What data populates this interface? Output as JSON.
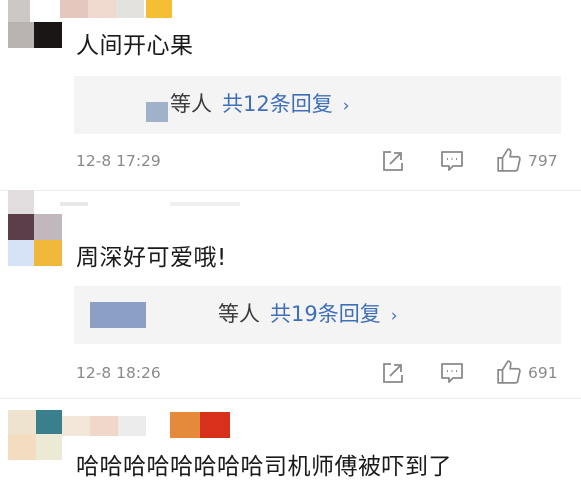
{
  "comments": [
    {
      "text": "人间开心果",
      "reply_by": "等人",
      "reply_count": "共12条回复",
      "date": "12-8 17:29",
      "likes": "797"
    },
    {
      "text": "周深好可爱哦!",
      "reply_by": "等人",
      "reply_count": "共19条回复",
      "date": "12-8 18:26",
      "likes": "691"
    },
    {
      "text": "哈哈哈哈哈哈哈哈司机师傅被吓到了"
    }
  ],
  "icons": {
    "share": "share-icon",
    "comment": "comment-icon",
    "like": "thumbs-up-icon",
    "chevron": "chevron-right-icon"
  },
  "colors": {
    "link": "#3f6fb7",
    "meta_gray": "#8a8a8a"
  }
}
